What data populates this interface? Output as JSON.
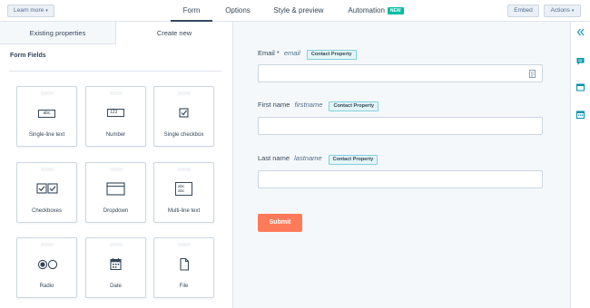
{
  "topbar": {
    "learn_more": "Learn more",
    "tabs": [
      {
        "label": "Form",
        "active": true
      },
      {
        "label": "Options",
        "active": false
      },
      {
        "label": "Style & preview",
        "active": false
      },
      {
        "label": "Automation",
        "active": false,
        "badge": "NEW"
      }
    ],
    "embed_label": "Embed",
    "actions_label": "Actions"
  },
  "left_panel": {
    "tabs": [
      {
        "label": "Existing properties",
        "active": false
      },
      {
        "label": "Create new",
        "active": true
      }
    ],
    "section_title": "Form Fields",
    "fields": [
      {
        "label": "Single-line text",
        "icon": "single-line-text-icon"
      },
      {
        "label": "Number",
        "icon": "number-icon"
      },
      {
        "label": "Single checkbox",
        "icon": "checkbox-icon"
      },
      {
        "label": "Checkboxes",
        "icon": "checkboxes-icon"
      },
      {
        "label": "Dropdown",
        "icon": "dropdown-icon"
      },
      {
        "label": "Multi-line text",
        "icon": "multi-line-text-icon"
      },
      {
        "label": "Radio",
        "icon": "radio-icon"
      },
      {
        "label": "Date",
        "icon": "calendar-icon"
      },
      {
        "label": "File",
        "icon": "file-icon"
      }
    ],
    "icon_text": {
      "abc": "abc",
      "num": "123"
    }
  },
  "form": {
    "fields": [
      {
        "label": "Email",
        "required_mark": "*",
        "internal_name": "email",
        "badge": "Contact Property",
        "value": ""
      },
      {
        "label": "First name",
        "internal_name": "firstname",
        "badge": "Contact Property",
        "value": ""
      },
      {
        "label": "Last name",
        "internal_name": "lastname",
        "badge": "Contact Property",
        "value": ""
      }
    ],
    "submit_label": "Submit"
  },
  "colors": {
    "accent": "#ff7a59",
    "badge_teal": "#00bda5",
    "property_badge_border": "#7fd1de",
    "text": "#33475b",
    "link_blue": "#0091ae"
  }
}
